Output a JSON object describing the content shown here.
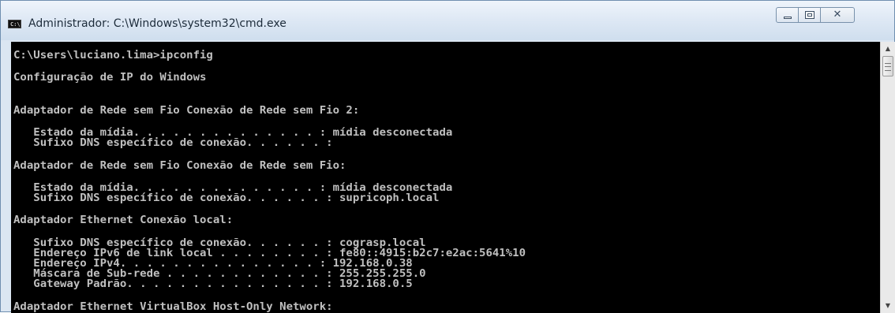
{
  "window": {
    "title": "Administrador: C:\\Windows\\system32\\cmd.exe",
    "icon": "cmd-icon",
    "icon_text": "C:\\"
  },
  "controls": {
    "minimize_icon": "minimize-icon",
    "maximize_icon": "maximize-icon",
    "close_icon": "close-icon",
    "close_glyph": "✕"
  },
  "console": {
    "lines": [
      "C:\\Users\\luciano.lima>ipconfig",
      "Configuração de IP do Windows",
      "Adaptador de Rede sem Fio Conexão de Rede sem Fio 2:",
      "   Estado da mídia. . . . . . . . . . . . . . : mídia desconectada",
      "   Sufixo DNS específico de conexão. . . . . . :",
      "Adaptador de Rede sem Fio Conexão de Rede sem Fio:",
      "   Estado da mídia. . . . . . . . . . . . . . : mídia desconectada",
      "   Sufixo DNS específico de conexão. . . . . . : supricoph.local",
      "Adaptador Ethernet Conexão local:",
      "   Sufixo DNS específico de conexão. . . . . . : cograsp.local",
      "   Endereço IPv6 de link local . . . . . . . . : fe80::4915:b2c7:e2ac:5641%10",
      "   Endereço IPv4. . . . . . . . . . . . . . . : 192.168.0.38",
      "   Máscara de Sub-rede . . . . . . . . . . . . : 255.255.255.0",
      "   Gateway Padrão. . . . . . . . . . . . . . . : 192.168.0.5",
      "Adaptador Ethernet VirtualBox Host-Only Network:"
    ]
  },
  "scrollbar": {
    "up_arrow": "▲",
    "down_arrow": "▼",
    "position": 0.0
  }
}
